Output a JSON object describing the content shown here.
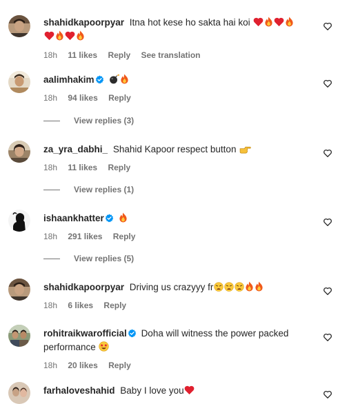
{
  "comments": [
    {
      "username": "shahidkapoorpyar",
      "verified": false,
      "text": "Itna hot kese ho sakta hai koi",
      "emojis": [
        "red-heart-emoji",
        "fire-emoji",
        "red-heart-emoji",
        "fire-emoji",
        "red-heart-emoji",
        "fire-emoji",
        "red-heart-emoji",
        "fire-emoji"
      ],
      "time": "18h",
      "likes": "11 likes",
      "reply": "Reply",
      "translate": "See translation"
    },
    {
      "username": "aalimhakim",
      "verified": true,
      "text": "",
      "emojis": [
        "bomb-emoji",
        "fire-emoji"
      ],
      "time": "18h",
      "likes": "94 likes",
      "reply": "Reply",
      "view_replies": "View replies (3)"
    },
    {
      "username": "za_yra_dabhi_",
      "verified": false,
      "text": "Shahid Kapoor respect button",
      "emojis": [
        "pointing-hand-emoji"
      ],
      "time": "18h",
      "likes": "11 likes",
      "reply": "Reply",
      "view_replies": "View replies (1)"
    },
    {
      "username": "ishaankhatter",
      "verified": true,
      "text": "",
      "emojis": [
        "fire-emoji"
      ],
      "time": "18h",
      "likes": "291 likes",
      "reply": "Reply",
      "view_replies": "View replies (5)"
    },
    {
      "username": "shahidkapoorpyar",
      "verified": false,
      "text": "Driving us crazyyy fr",
      "emojis": [
        "weary-face-emoji",
        "weary-face-emoji",
        "weary-face-emoji",
        "fire-emoji",
        "fire-emoji"
      ],
      "time": "18h",
      "likes": "6 likes",
      "reply": "Reply"
    },
    {
      "username": "rohitraikwarofficial",
      "verified": true,
      "text": "Doha will witness the power packed performance",
      "emojis": [
        "star-struck-emoji"
      ],
      "time": "18h",
      "likes": "20 likes",
      "reply": "Reply"
    },
    {
      "username": "farhaloveshahid",
      "verified": false,
      "text": "Baby I love you",
      "emojis": [
        "red-heart-emoji"
      ]
    }
  ],
  "colors": {
    "text": "#262626",
    "secondary": "#737373",
    "verified": "#0095f6"
  }
}
